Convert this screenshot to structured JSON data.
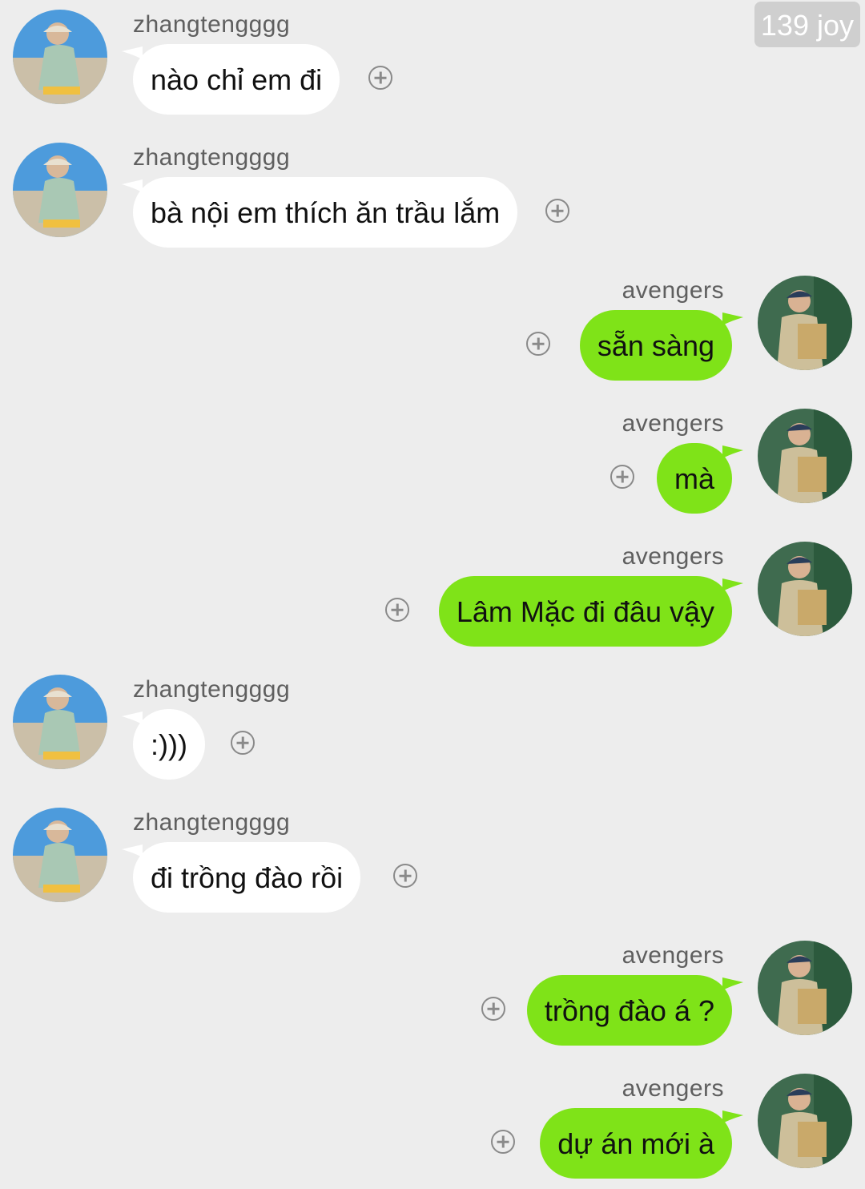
{
  "watermark": "139 joy",
  "users": {
    "left": "zhangtengggg",
    "right": "avengers"
  },
  "messages": [
    {
      "side": "left",
      "username": "zhangtengggg",
      "text": "nào chỉ em đi"
    },
    {
      "side": "left",
      "username": "zhangtengggg",
      "text": "bà nội em thích ăn trầu lắm"
    },
    {
      "side": "right",
      "username": "avengers",
      "text": "sẵn sàng"
    },
    {
      "side": "right",
      "username": "avengers",
      "text": "mà"
    },
    {
      "side": "right",
      "username": "avengers",
      "text": "Lâm Mặc đi đâu vậy"
    },
    {
      "side": "left",
      "username": "zhangtengggg",
      "text": ":)))"
    },
    {
      "side": "left",
      "username": "zhangtengggg",
      "text": "đi trồng đào rồi"
    },
    {
      "side": "right",
      "username": "avengers",
      "text": "trồng đào á ?"
    },
    {
      "side": "right",
      "username": "avengers",
      "text": "dự án mới à"
    }
  ],
  "icons": {
    "reaction": "add-reaction-icon",
    "avatar": "user-avatar"
  },
  "colors": {
    "background": "#ededed",
    "incoming_bubble": "#ffffff",
    "outgoing_bubble": "#7fe318"
  }
}
